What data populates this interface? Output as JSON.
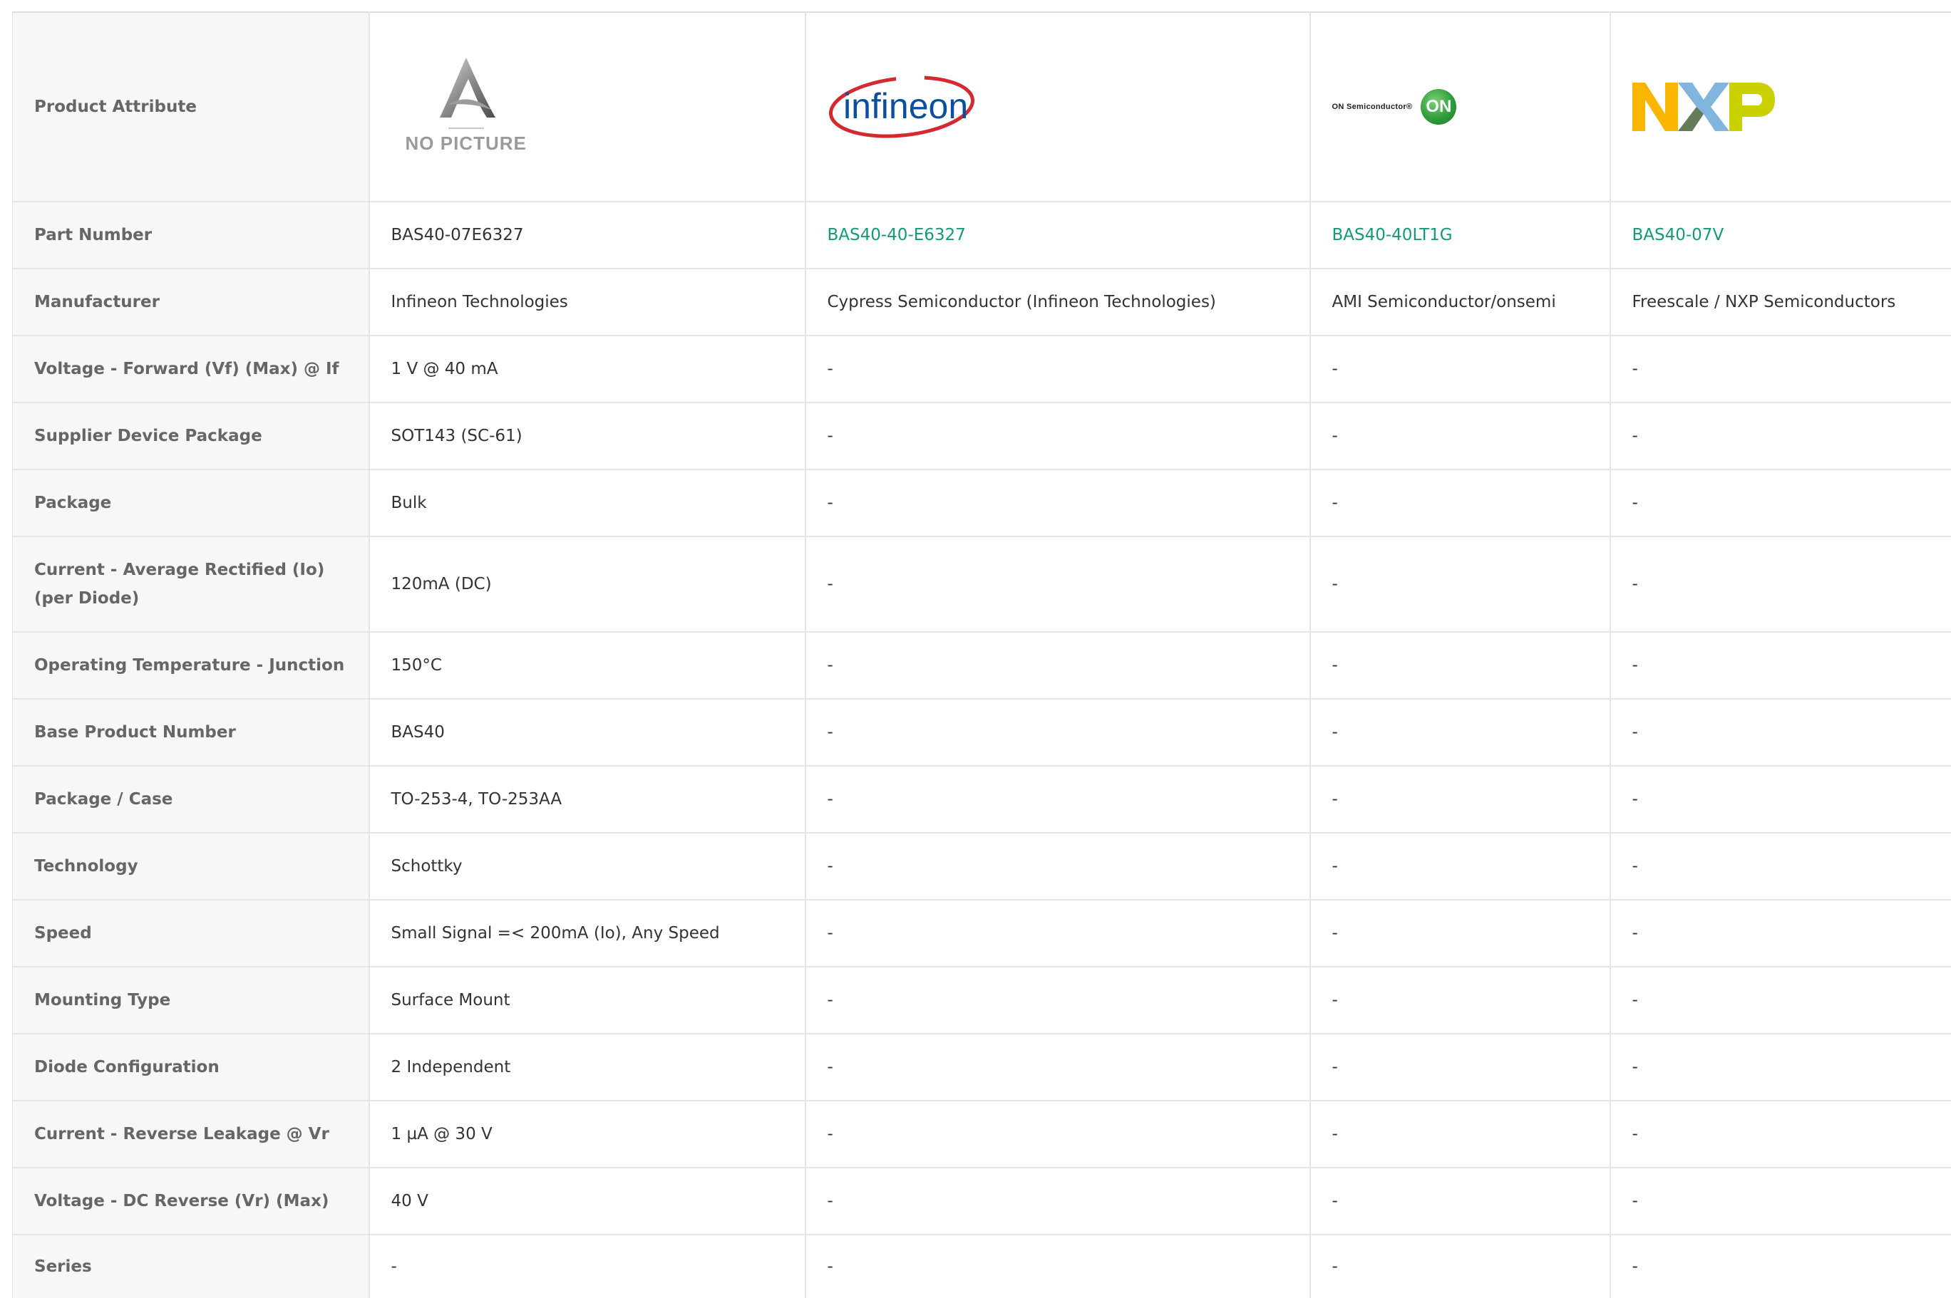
{
  "header": {
    "label": "Product Attribute",
    "nopic_text": "NO PICTURE",
    "logos": [
      "no-picture",
      "infineon-logo",
      "onsemi-logo",
      "nxp-logo"
    ],
    "infineon_text": "infineon",
    "onsemi_text": "ON Semiconductor®",
    "onsemi_badge": "ON",
    "nxp_letters": [
      "N",
      "X",
      "P"
    ]
  },
  "colors": {
    "link": "#129a7b",
    "label_bg": "#f7f7f7",
    "border": "#e6e6e6",
    "infineon_red": "#d42a2f",
    "infineon_blue": "#0a4f9e",
    "nxp_orange": "#f9b500",
    "nxp_blue": "#7bb1db",
    "nxp_green": "#c9d200"
  },
  "rows": [
    {
      "label": "Part Number",
      "values": [
        "BAS40-07E6327",
        "BAS40-40-E6327",
        "BAS40-40LT1G",
        "BAS40-07V"
      ]
    },
    {
      "label": "Manufacturer",
      "values": [
        "Infineon Technologies",
        "Cypress Semiconductor (Infineon Technologies)",
        "AMI Semiconductor/onsemi",
        "Freescale / NXP Semiconductors"
      ]
    },
    {
      "label": "Voltage - Forward (Vf) (Max) @ If",
      "values": [
        "1 V @ 40 mA",
        "-",
        "-",
        "-"
      ]
    },
    {
      "label": "Supplier Device Package",
      "values": [
        "SOT143 (SC-61)",
        "-",
        "-",
        "-"
      ]
    },
    {
      "label": "Package",
      "values": [
        "Bulk",
        "-",
        "-",
        "-"
      ]
    },
    {
      "label": "Current - Average Rectified (Io) (per Diode)",
      "values": [
        "120mA (DC)",
        "-",
        "-",
        "-"
      ]
    },
    {
      "label": "Operating Temperature - Junction",
      "values": [
        "150°C",
        "-",
        "-",
        "-"
      ]
    },
    {
      "label": "Base Product Number",
      "values": [
        "BAS40",
        "-",
        "-",
        "-"
      ]
    },
    {
      "label": "Package / Case",
      "values": [
        "TO-253-4, TO-253AA",
        "-",
        "-",
        "-"
      ]
    },
    {
      "label": "Technology",
      "values": [
        "Schottky",
        "-",
        "-",
        "-"
      ]
    },
    {
      "label": "Speed",
      "values": [
        "Small Signal =< 200mA (Io), Any Speed",
        "-",
        "-",
        "-"
      ]
    },
    {
      "label": "Mounting Type",
      "values": [
        "Surface Mount",
        "-",
        "-",
        "-"
      ]
    },
    {
      "label": "Diode Configuration",
      "values": [
        "2 Independent",
        "-",
        "-",
        "-"
      ]
    },
    {
      "label": "Current - Reverse Leakage @ Vr",
      "values": [
        "1 µA @ 30 V",
        "-",
        "-",
        "-"
      ]
    },
    {
      "label": "Voltage - DC Reverse (Vr) (Max)",
      "values": [
        "40 V",
        "-",
        "-",
        "-"
      ]
    },
    {
      "label": "Series",
      "values": [
        "-",
        "-",
        "-",
        "-"
      ]
    }
  ]
}
